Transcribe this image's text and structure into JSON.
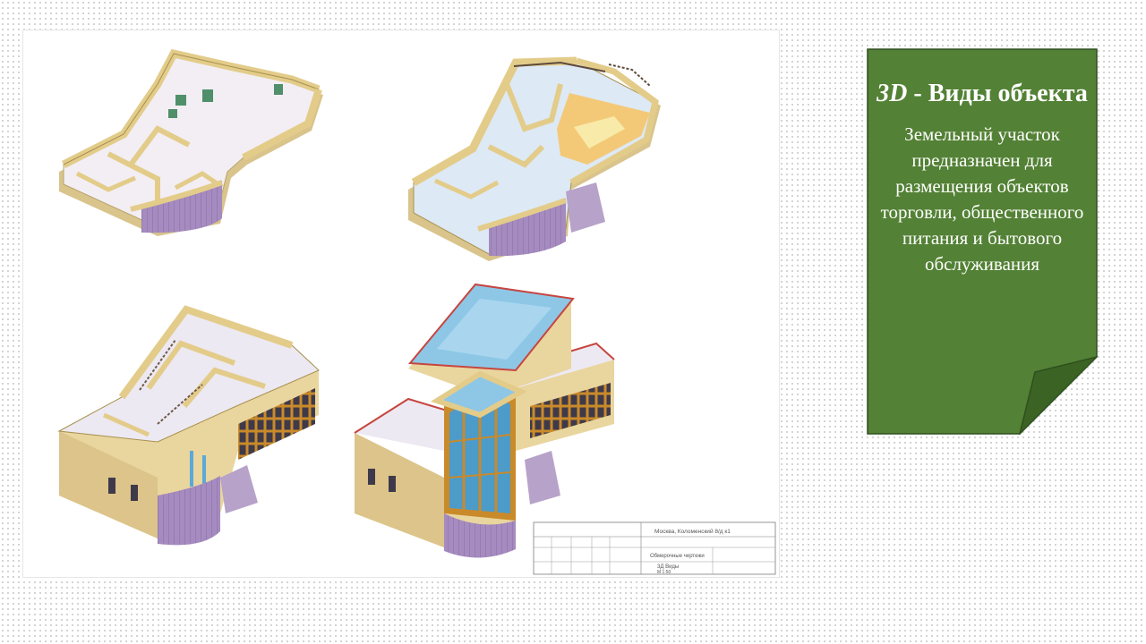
{
  "card": {
    "title_prefix": "3D",
    "title_rest": " - Виды объекта",
    "body": "Земельный участок предназначен для размещения объектов торговли, общественного питания и бытового обслуживания"
  },
  "title_block": {
    "address": "Москва, Коломенский 8/д к1",
    "sheet_name": "Обмерочные чертежи",
    "views_label": "3Д Виды",
    "scale": "М 1:50"
  },
  "colors": {
    "card_fill": "#538135",
    "card_border": "#2f4f1e",
    "wall_beige": "#e9d59e",
    "wall_purple": "#a58bbf",
    "floor_light": "#f1eef2",
    "glass_blue": "#8ec7e6",
    "railing_red": "#c7453f"
  }
}
